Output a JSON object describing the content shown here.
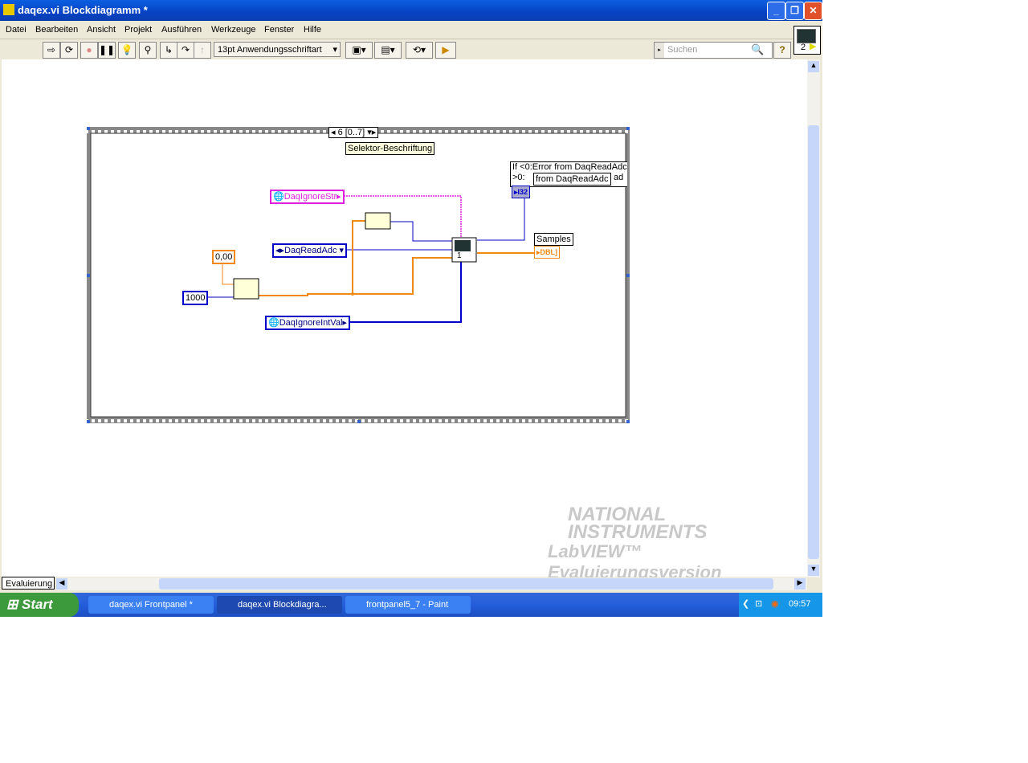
{
  "window": {
    "title": "daqex.vi Blockdiagramm *"
  },
  "menu": [
    "Datei",
    "Bearbeiten",
    "Ansicht",
    "Projekt",
    "Ausführen",
    "Werkzeuge",
    "Fenster",
    "Hilfe"
  ],
  "toolbar": {
    "font_select": "13pt Anwendungsschriftart",
    "search_placeholder": "Suchen",
    "help": "?",
    "vi_icon_num": "2"
  },
  "diagram": {
    "selector": "6 [0..7]",
    "selector_label": "Selektor-Beschriftung",
    "const_str": "DaqIgnoreStr",
    "const_enum": "DaqReadAdc",
    "const_intval": "DaqIgnoreIntVal",
    "const_zero": "0,00",
    "const_1000": "1000",
    "node_index": "1",
    "comment_line1": "If <0:Error from DaqReadAdc",
    "comment_line2": ">0:",
    "comment_overlay": "from DaqReadAdc",
    "comment_tail": "ad",
    "i32": "I32",
    "samples_label": "Samples",
    "dbl": "DBL"
  },
  "watermark": {
    "brand1": "NATIONAL",
    "brand2": "INSTRUMENTS",
    "edition": "LabVIEW™ Evaluierungsversion"
  },
  "status": {
    "evaluation_tab": "Evaluierung"
  },
  "taskbar": {
    "start": "Start",
    "tasks": [
      "daqex.vi Frontpanel *",
      "daqex.vi Blockdiagra...",
      "frontpanel5_7 - Paint"
    ],
    "clock": "09:57"
  },
  "colors": {
    "wire_int": "#0000c8",
    "wire_dbl": "#f08a14",
    "wire_str": "#e020e0"
  }
}
